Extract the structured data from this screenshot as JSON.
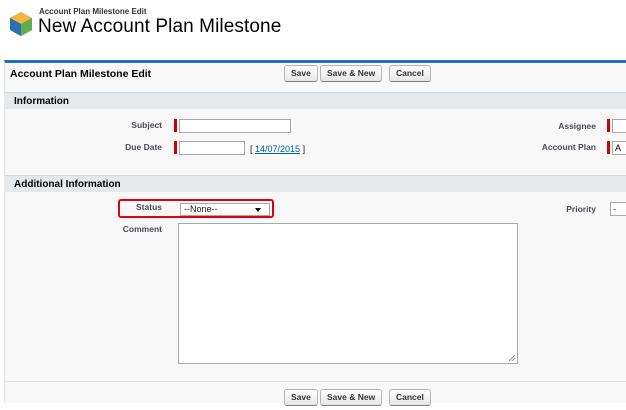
{
  "header": {
    "breadcrumb": "Account Plan Milestone Edit",
    "title": "New Account Plan Milestone"
  },
  "edit_block": {
    "title": "Account Plan Milestone Edit",
    "buttons": {
      "save": "Save",
      "save_new": "Save & New",
      "cancel": "Cancel"
    }
  },
  "information": {
    "heading": "Information",
    "subject": {
      "label": "Subject",
      "value": ""
    },
    "due_date": {
      "label": "Due Date",
      "value": "",
      "link_prefix": "[ ",
      "link_text": "14/07/2015",
      "link_suffix": " ]"
    },
    "assignee": {
      "label": "Assignee"
    },
    "account_plan": {
      "label": "Account Plan",
      "value": "A"
    }
  },
  "additional": {
    "heading": "Additional Information",
    "status": {
      "label": "Status",
      "selected": "--None--"
    },
    "priority": {
      "label": "Priority",
      "selected": "-"
    },
    "comment": {
      "label": "Comment",
      "value": ""
    }
  },
  "footer_buttons": {
    "save": "Save",
    "save_new": "Save & New",
    "cancel": "Cancel"
  },
  "colors": {
    "accent": "#236fbd",
    "required": "#cc0000",
    "highlight": "#e1000f"
  }
}
